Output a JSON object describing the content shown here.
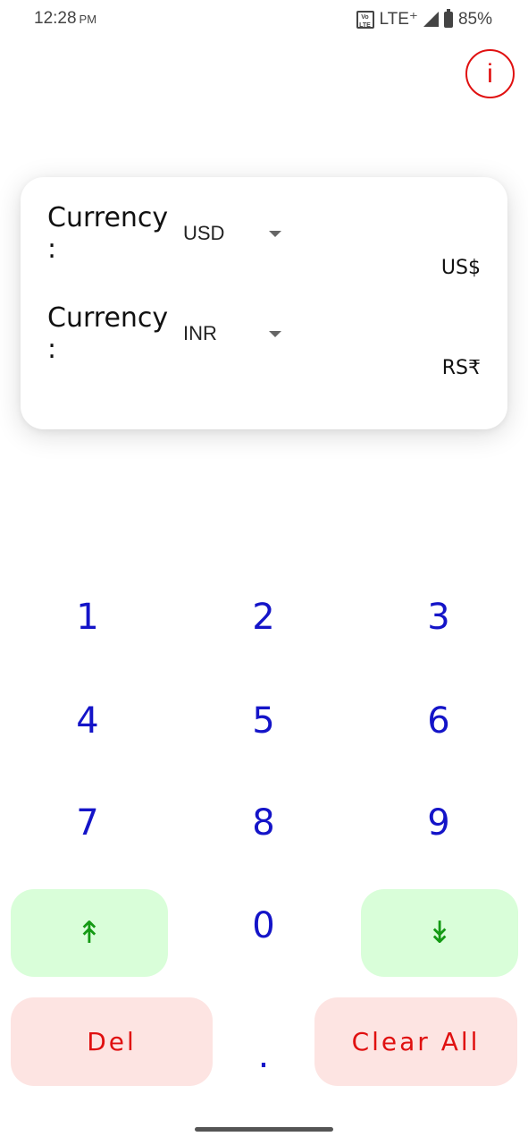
{
  "status_bar": {
    "time": "12:28",
    "ampm": "PM",
    "volte": "Vo LTE",
    "network": "LTE⁺",
    "battery": "85%"
  },
  "info_button": {
    "label": "i",
    "icon": "info-icon",
    "color": "#e01010"
  },
  "converter": {
    "from": {
      "label": "Currency :",
      "selected": "USD",
      "symbol": "US$"
    },
    "to": {
      "label": "Currency :",
      "selected": "INR",
      "symbol": "RS₹"
    }
  },
  "keypad": {
    "digits": [
      "1",
      "2",
      "3",
      "4",
      "5",
      "6",
      "7",
      "8",
      "9",
      "0"
    ],
    "dot": ".",
    "swap_up": {
      "glyph": "↟",
      "icon": "up-arrow-icon"
    },
    "swap_down": {
      "glyph": "↡",
      "icon": "down-arrow-icon"
    },
    "del_label": "Del",
    "clear_label": "Clear All",
    "colors": {
      "digit": "#1414c8",
      "green_bg": "#d9fed9",
      "green_fg": "#149a14",
      "red_bg": "#fde4e2",
      "red_fg": "#e01010"
    }
  }
}
